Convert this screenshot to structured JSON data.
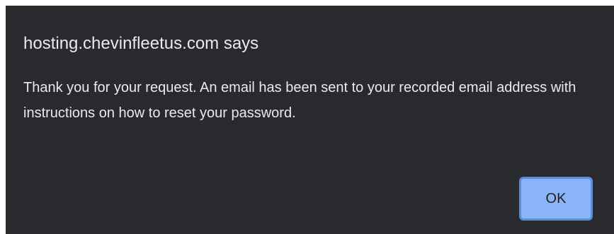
{
  "dialog": {
    "title": "hosting.chevinfleetus.com says",
    "message": "Thank you for your request. An email has been sent to your recorded email address with instructions on how to reset your password.",
    "ok_label": "OK"
  },
  "colors": {
    "background": "#292a2d",
    "text": "#e8eaed",
    "button": "#8ab4f8",
    "button_border": "#5b8dd9"
  }
}
